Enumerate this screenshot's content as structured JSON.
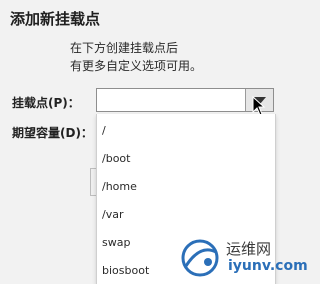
{
  "dialog": {
    "title": "添加新挂载点",
    "description_line1": "在下方创建挂载点后",
    "description_line2": "有更多自定义选项可用。"
  },
  "form": {
    "mount_point_label": "挂载点(P)：",
    "mount_point_value": "",
    "capacity_label": "期望容量(D)："
  },
  "dropdown": {
    "options": [
      "/",
      "/boot",
      "/home",
      "/var",
      "swap",
      "biosboot"
    ]
  },
  "watermark": {
    "text_cn": "运维网",
    "text_en": "iyunv.com"
  }
}
